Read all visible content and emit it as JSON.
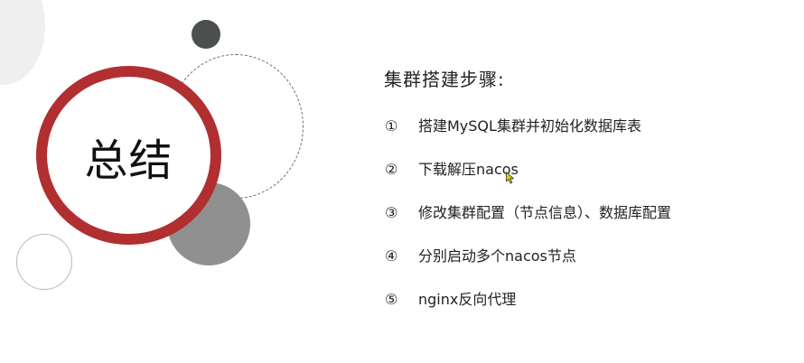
{
  "slide": {
    "title": "总结",
    "steps_heading": "集群搭建步骤:",
    "steps": [
      {
        "num": "①",
        "text": "搭建MySQL集群并初始化数据库表"
      },
      {
        "num": "②",
        "text": "下载解压nacos"
      },
      {
        "num": "③",
        "text": "修改集群配置（节点信息）、数据库配置"
      },
      {
        "num": "④",
        "text": "分别启动多个nacos节点"
      },
      {
        "num": "⑤",
        "text": "nginx反向代理"
      }
    ]
  },
  "colors": {
    "ring_red": "#b12f30",
    "dark_dot": "#4c4f4f",
    "gray_disc": "#909090",
    "cursor_yellow": "#d6d400"
  },
  "icons": {
    "cursor": "mouse-pointer-icon"
  }
}
